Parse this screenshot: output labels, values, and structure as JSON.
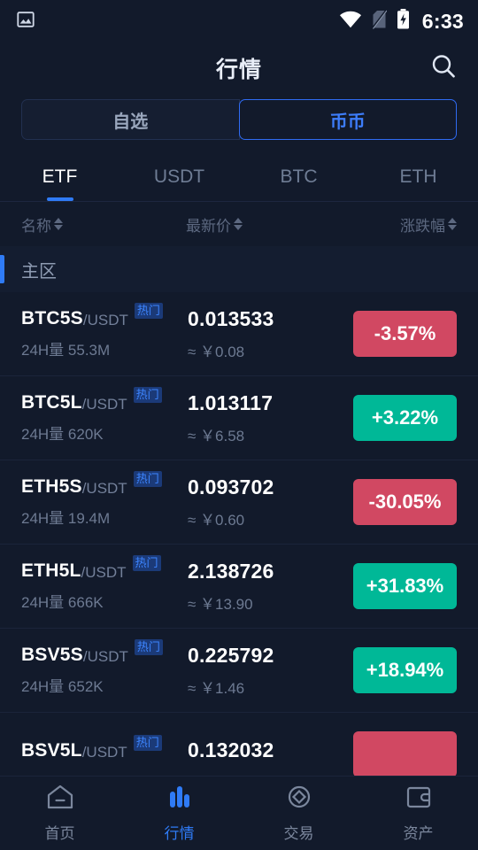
{
  "statusbar": {
    "screenshot_icon": "image-icon",
    "wifi_icon": "wifi-icon",
    "sim_icon": "sim-card-off-icon",
    "battery_icon": "battery-charging-icon",
    "time": "6:33"
  },
  "header": {
    "title": "行情",
    "search_icon": "search-icon"
  },
  "segment": {
    "items": [
      {
        "label": "自选",
        "active": false
      },
      {
        "label": "币币",
        "active": true
      }
    ]
  },
  "tabs": [
    {
      "label": "ETF",
      "active": true
    },
    {
      "label": "USDT",
      "active": false
    },
    {
      "label": "BTC",
      "active": false
    },
    {
      "label": "ETH",
      "active": false
    }
  ],
  "columns": {
    "name": "名称",
    "price": "最新价",
    "change": "涨跌幅",
    "sort_icon": "sort-arrows-icon"
  },
  "zone": {
    "label": "主区"
  },
  "rows": [
    {
      "symbol": "BTC5S",
      "pair": "/USDT",
      "badge": "热门",
      "volume": "24H量 55.3M",
      "price": "0.013533",
      "cny": "≈ ￥0.08",
      "change": "-3.57%",
      "direction": "down"
    },
    {
      "symbol": "BTC5L",
      "pair": "/USDT",
      "badge": "热门",
      "volume": "24H量 620K",
      "price": "1.013117",
      "cny": "≈ ￥6.58",
      "change": "+3.22%",
      "direction": "up"
    },
    {
      "symbol": "ETH5S",
      "pair": "/USDT",
      "badge": "热门",
      "volume": "24H量 19.4M",
      "price": "0.093702",
      "cny": "≈ ￥0.60",
      "change": "-30.05%",
      "direction": "down"
    },
    {
      "symbol": "ETH5L",
      "pair": "/USDT",
      "badge": "热门",
      "volume": "24H量 666K",
      "price": "2.138726",
      "cny": "≈ ￥13.90",
      "change": "+31.83%",
      "direction": "up"
    },
    {
      "symbol": "BSV5S",
      "pair": "/USDT",
      "badge": "热门",
      "volume": "24H量 652K",
      "price": "0.225792",
      "cny": "≈ ￥1.46",
      "change": "+18.94%",
      "direction": "up"
    },
    {
      "symbol": "BSV5L",
      "pair": "/USDT",
      "badge": "热门",
      "volume": "",
      "price": "0.132032",
      "cny": "",
      "change": "",
      "direction": "down"
    }
  ],
  "bottomnav": [
    {
      "label": "首页",
      "icon": "home-icon",
      "active": false
    },
    {
      "label": "行情",
      "icon": "bar-chart-icon",
      "active": true
    },
    {
      "label": "交易",
      "icon": "trade-diamond-icon",
      "active": false
    },
    {
      "label": "资产",
      "icon": "wallet-icon",
      "active": false
    }
  ],
  "colors": {
    "background": "#121a2b",
    "accent": "#2f7bf6",
    "up": "#00b897",
    "down": "#d14862",
    "badge_bg": "#1b3a78"
  }
}
